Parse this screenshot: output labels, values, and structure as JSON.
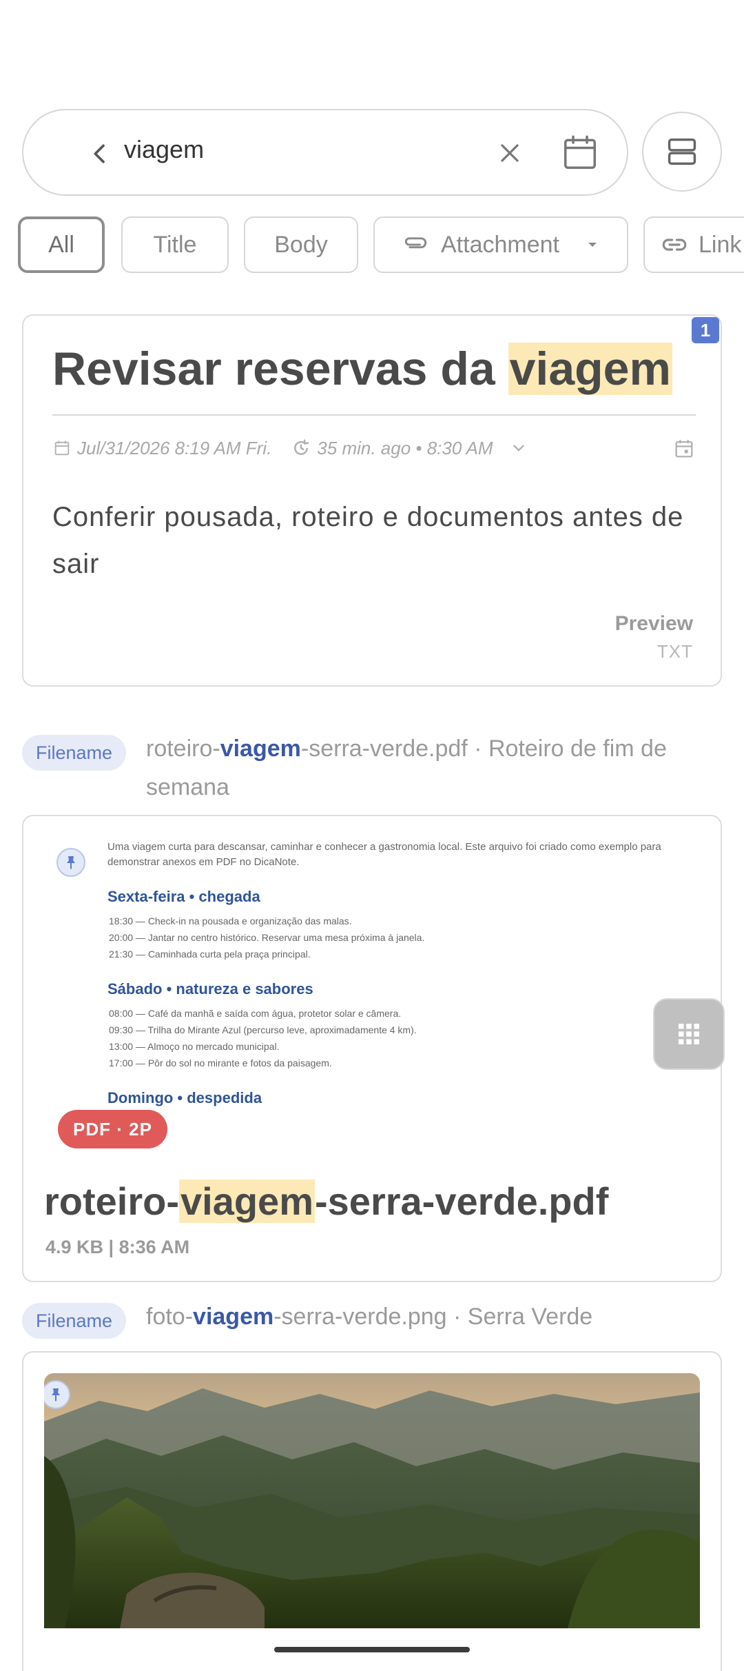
{
  "search": {
    "query": "viagem"
  },
  "filters": [
    {
      "label": "All",
      "active": true
    },
    {
      "label": "Title",
      "active": false
    },
    {
      "label": "Body",
      "active": false
    },
    {
      "label": "Attachment",
      "active": false
    },
    {
      "label": "Link",
      "active": false
    }
  ],
  "note": {
    "badge": "1",
    "title_prefix": "Revisar reservas da ",
    "title_match": "viagem",
    "created": "Jul/31/2026 8:19 AM Fri.",
    "reminder": "35 min. ago • 8:30 AM",
    "body": "Conferir pousada, roteiro e documentos antes de sair",
    "preview_label": "Preview",
    "preview_type": "TXT"
  },
  "pdf_match": {
    "badge": "Filename",
    "text_before": "roteiro-",
    "text_match": "viagem",
    "text_after": "-serra-verde.pdf · Roteiro de fim de semana"
  },
  "pdf_attachment": {
    "preview": {
      "intro": "Uma viagem curta para descansar, caminhar e conhecer a gastronomia local. Este arquivo foi criado como exemplo para demonstrar anexos em PDF no DicaNote.",
      "sections": [
        {
          "heading": "Sexta-feira • chegada",
          "lines": [
            "18:30 — Check-in na pousada e organização das malas.",
            "20:00 — Jantar no centro histórico. Reservar uma mesa próxima à janela.",
            "21:30 — Caminhada curta pela praça principal."
          ]
        },
        {
          "heading": "Sábado • natureza e sabores",
          "lines": [
            "08:00 — Café da manhã e saída com água, protetor solar e câmera.",
            "09:30 — Trilha do Mirante Azul (percurso leve, aproximadamente 4 km).",
            "13:00 — Almoço no mercado municipal.",
            "17:00 — Pôr do sol no mirante e fotos da paisagem."
          ]
        },
        {
          "heading": "Domingo • despedida",
          "lines": []
        }
      ]
    },
    "type_pill": "PDF · 2P",
    "name_before": "roteiro-",
    "name_match": "viagem",
    "name_after": "-serra-verde.pdf",
    "meta": "4.9 KB | 8:36 AM"
  },
  "image_match": {
    "badge": "Filename",
    "text_before": "foto-",
    "text_match": "viagem",
    "text_after": "-serra-verde.png · Serra Verde"
  },
  "colors": {
    "accent": "#5a7ad1",
    "highlight": "#fde9b6",
    "match_text": "#3a58a8",
    "pdf_pill": "#e05a5a",
    "badge_bg": "#e6ebf7"
  }
}
